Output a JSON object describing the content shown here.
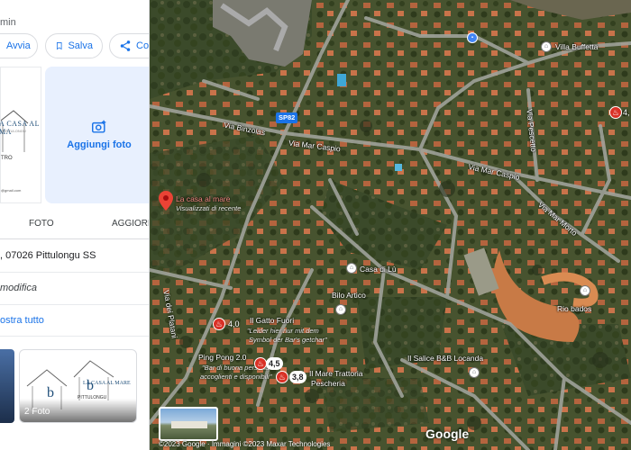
{
  "panel": {
    "duration": "min",
    "actions": {
      "avvia": "Avvia",
      "salva": "Salva",
      "condividi": "Cor"
    },
    "photo_logo": {
      "name": "A CASA AL MA",
      "sub": "PITTULONGU",
      "tro": "TRO",
      "mail": "@gmail.com"
    },
    "add_photo": "Aggiungi foto",
    "tabs": {
      "foto": "FOTO",
      "aggiorna": "AGGIORNA"
    },
    "address": ", 07026 Pittulongu SS",
    "suggest_edit": "modifica",
    "show_all": "ostra tutto",
    "gallery": {
      "count": "2 Foto",
      "logo": "LA CASA AL MARE",
      "logo_sub": "PITTULONGU"
    }
  },
  "map": {
    "roads": {
      "via_binzolas": "Via Binzolas",
      "via_mar_caspio_1": "Via Mar Caspio",
      "via_mar_caspio_2": "Via Mar Caspio",
      "via_mar_morto": "Via Mar Morto",
      "via_pescetto": "Via Pescetto",
      "via_dei_platani": "Via dei Platani",
      "shield_sp82": "SP82"
    },
    "pois": {
      "villa_buffetta": "Villa Buffetta",
      "selected_name": "La casa al mare",
      "selected_sub": "Visualizzati di recente",
      "casa_di_lu": "Casa di Lù",
      "bilo_artico": "Bilo Artico",
      "rio_bados": "Rio bados",
      "il_gatto_fuori": "Il Gatto Fuori",
      "gatto_sub_1": "\"Leider hier nur mit dem",
      "gatto_sub_2": "Symbol der Bar's getchar\"",
      "ping_pong": "Ping Pong 2.0",
      "ping_sub_1": "\"Bar di buona persona e",
      "ping_sub_2": "accoglienti e disponibili\"",
      "il_mare": "Il Mare Trattoria",
      "il_mare_2": "Pescheria",
      "il_salice": "Il Salice B&B Locanda"
    },
    "ratings": {
      "gatto": "4,0",
      "ping": "4,5",
      "mare": "3,8",
      "east": "4,"
    },
    "google": "Google",
    "copyright": "©2023 Google · Immagini ©2023 Maxar Technologies"
  }
}
